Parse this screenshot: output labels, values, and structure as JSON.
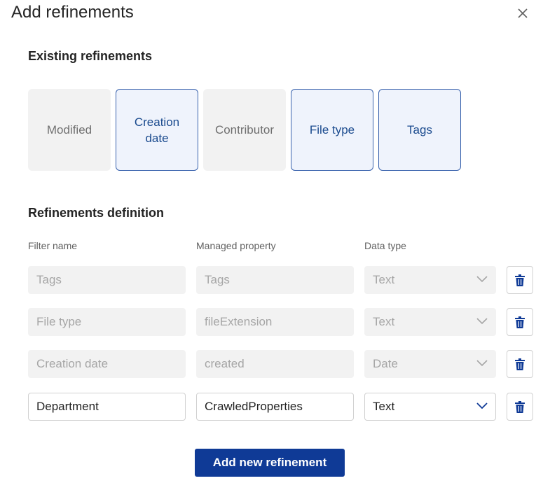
{
  "dialog": {
    "title": "Add refinements",
    "close_icon": "close-icon"
  },
  "existing": {
    "heading": "Existing refinements",
    "chips": [
      {
        "label": "Modified",
        "selected": false
      },
      {
        "label": "Creation date",
        "selected": true
      },
      {
        "label": "Contributor",
        "selected": false
      },
      {
        "label": "File type",
        "selected": true
      },
      {
        "label": "Tags",
        "selected": true
      }
    ]
  },
  "definition": {
    "heading": "Refinements definition",
    "columns": [
      "Filter name",
      "Managed property",
      "Data type"
    ],
    "rows": [
      {
        "filter_name": "Tags",
        "managed_property": "Tags",
        "data_type": "Text",
        "disabled": true
      },
      {
        "filter_name": "File type",
        "managed_property": "fileExtension",
        "data_type": "Text",
        "disabled": true
      },
      {
        "filter_name": "Creation date",
        "managed_property": "created",
        "data_type": "Date",
        "disabled": true
      },
      {
        "filter_name": "Department",
        "managed_property": "CrawledProperties",
        "data_type": "Text",
        "disabled": false
      }
    ],
    "delete_icon": "trash-icon",
    "dropdown_icon": "chevron-down-icon"
  },
  "actions": {
    "add_label": "Add new refinement"
  },
  "colors": {
    "primary": "#0f3a96",
    "selected_chip_bg": "#eff3fc",
    "selected_chip_border": "#3a63ad",
    "disabled_bg": "#f2f2f2"
  }
}
